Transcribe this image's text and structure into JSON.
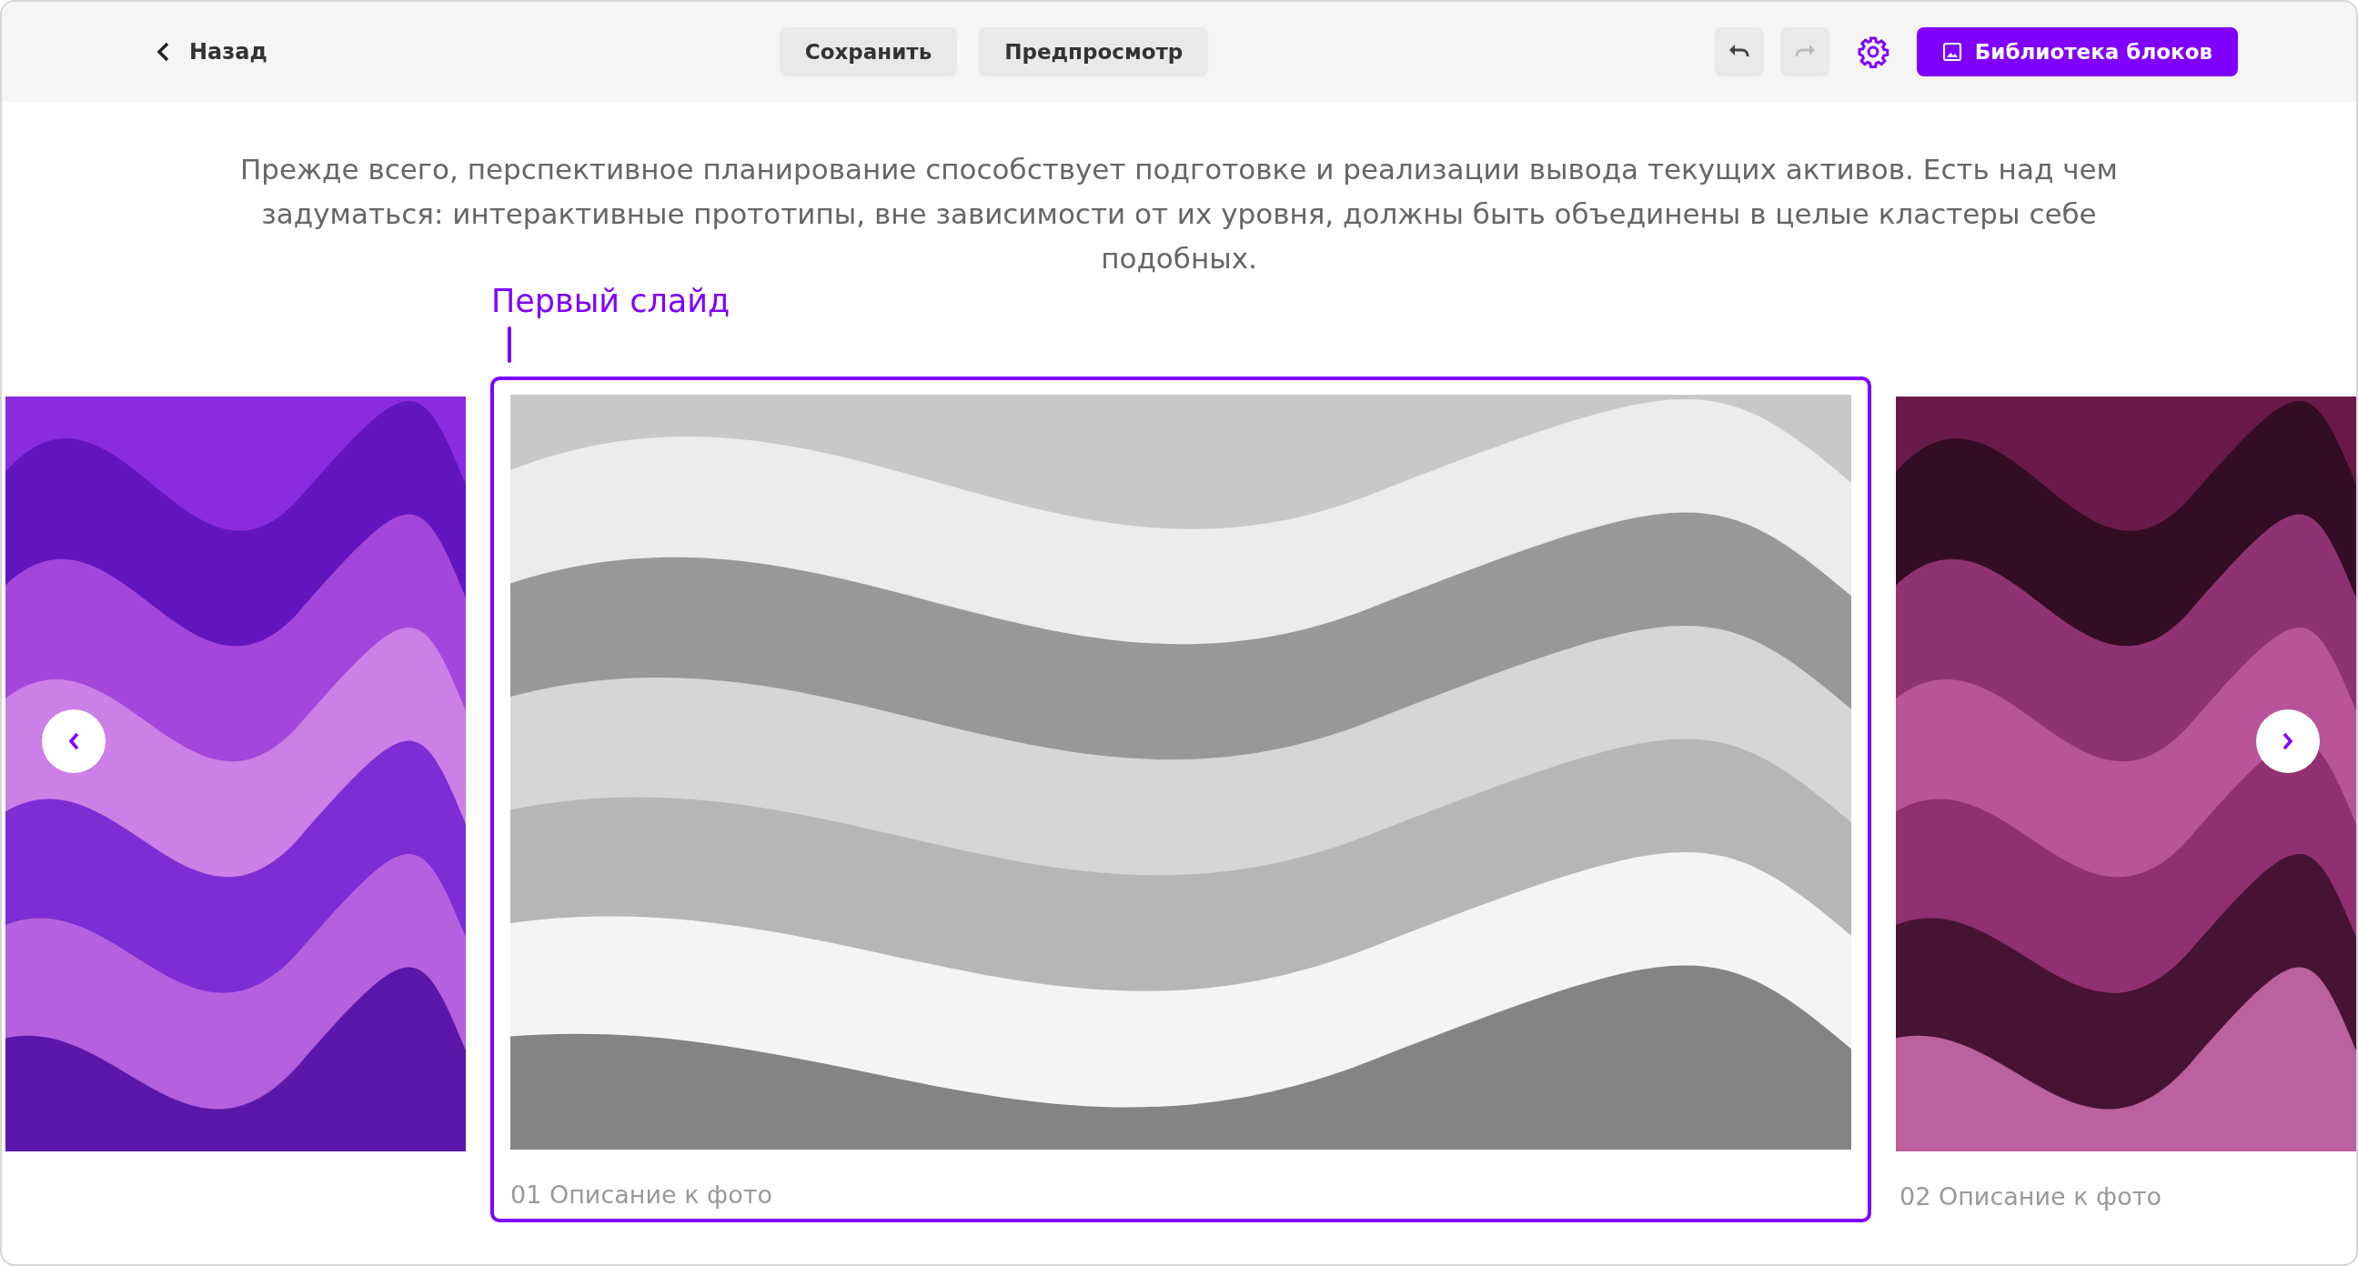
{
  "toolbar": {
    "back": "Назад",
    "buttons": [
      {
        "label": "Сохранить"
      },
      {
        "label": "Предпросмотр"
      }
    ],
    "undo": {
      "disabled": false
    },
    "redo": {
      "disabled": true
    },
    "library": "Библиотека блоков"
  },
  "intro": "Прежде всего, перспективное планирование способствует подготовке и реализации вывода текущих активов. Есть над чем задуматься: интерактивные прототипы, вне зависимости от их уровня, должны быть объединены в целые кластеры себе подобных.",
  "slide_label": "Первый слайд",
  "slides": [
    {
      "selected": false
    },
    {
      "selected": true,
      "caption": "01 Описание к фото"
    },
    {
      "selected": false,
      "caption": "02 Описание к фото"
    }
  ]
}
